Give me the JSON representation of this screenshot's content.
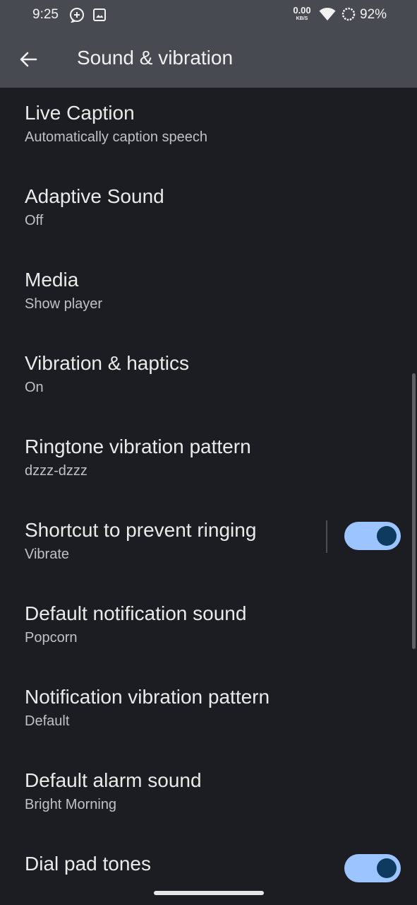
{
  "status_bar": {
    "time": "9:25",
    "net_speed_value": "0.00",
    "net_speed_unit": "KB/S",
    "battery": "92%",
    "icons": [
      "assistant-plus-icon",
      "image-icon",
      "wifi-icon",
      "battery-ring-icon"
    ]
  },
  "app_bar": {
    "title": "Sound & vibration",
    "back_icon": "arrow-left-icon"
  },
  "items": [
    {
      "title": "Live Caption",
      "summary": "Automatically caption speech"
    },
    {
      "title": "Adaptive Sound",
      "summary": "Off"
    },
    {
      "title": "Media",
      "summary": "Show player"
    },
    {
      "title": "Vibration & haptics",
      "summary": "On"
    },
    {
      "title": "Ringtone vibration pattern",
      "summary": "dzzz-dzzz"
    },
    {
      "title": "Shortcut to prevent ringing",
      "summary": "Vibrate",
      "toggle": true,
      "toggle_on": true
    },
    {
      "title": "Default notification sound",
      "summary": "Popcorn"
    },
    {
      "title": "Notification vibration pattern",
      "summary": "Default"
    },
    {
      "title": "Default alarm sound",
      "summary": "Bright Morning"
    },
    {
      "title": "Dial pad tones",
      "summary": "",
      "toggle": true,
      "toggle_on": true
    }
  ],
  "colors": {
    "background": "#1b1d22",
    "header": "#474a50",
    "toggle_track_on": "#9cc4ff",
    "toggle_thumb_on": "#0f3a5f"
  }
}
